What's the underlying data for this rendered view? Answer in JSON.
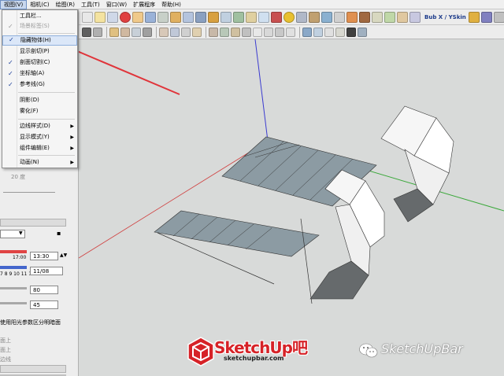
{
  "menubar": {
    "items": [
      "视图(V)",
      "相机(C)",
      "绘图(R)",
      "工具(T)",
      "窗口(W)",
      "扩展程序",
      "帮助(H)"
    ]
  },
  "toolbar": {
    "brand_label": "Bub X / YSkin"
  },
  "view_menu": {
    "items": [
      {
        "label": "工具栏...",
        "checked": false,
        "disabled": false,
        "submenu": false
      },
      {
        "label": "场景标签(S)",
        "checked": true,
        "disabled": true,
        "submenu": false
      },
      {
        "label": "隐藏物体(H)",
        "checked": true,
        "disabled": false,
        "submenu": false,
        "highlighted": true
      },
      {
        "label": "显示剖切(P)",
        "checked": false,
        "disabled": false,
        "submenu": false
      },
      {
        "label": "剖面切割(C)",
        "checked": true,
        "disabled": false,
        "submenu": false
      },
      {
        "label": "坐标轴(A)",
        "checked": true,
        "disabled": false,
        "submenu": false
      },
      {
        "label": "参考线(G)",
        "checked": true,
        "disabled": false,
        "submenu": false
      },
      {
        "label": "阴影(D)",
        "checked": false,
        "disabled": false,
        "submenu": false
      },
      {
        "label": "雾化(F)",
        "checked": false,
        "disabled": false,
        "submenu": false
      },
      {
        "label": "边线样式(D)",
        "checked": false,
        "disabled": false,
        "submenu": true
      },
      {
        "label": "显示模式(Y)",
        "checked": false,
        "disabled": false,
        "submenu": true
      },
      {
        "label": "组件编辑(E)",
        "checked": false,
        "disabled": false,
        "submenu": true
      },
      {
        "label": "动画(N)",
        "checked": false,
        "disabled": false,
        "submenu": true
      }
    ]
  },
  "tray": {
    "angle_value": "20 度",
    "time_start": "17:00",
    "time_value": "13:30",
    "hours": "7 8 9 10 11 12",
    "date_value": "11/08",
    "light_value": "80",
    "dark_value": "45",
    "sun_shading_label": "使用阳光参数区分明暗面",
    "face_on_label": "面上",
    "face_on_label2": "面上",
    "edge_label": "边线"
  },
  "watermark": {
    "logo_title": "SketchUp",
    "logo_suffix": "吧",
    "logo_url": "sketchupbar.com",
    "wechat_name": "SketchUpBar"
  },
  "colors": {
    "highlight_arrow": "#e0343a",
    "axis_blue": "#3a3ad0",
    "axis_red": "#d04040",
    "axis_green": "#3aa83a",
    "face_gray": "#8c9ba3",
    "face_dark": "#666a6c",
    "brand_red": "#d62227"
  }
}
